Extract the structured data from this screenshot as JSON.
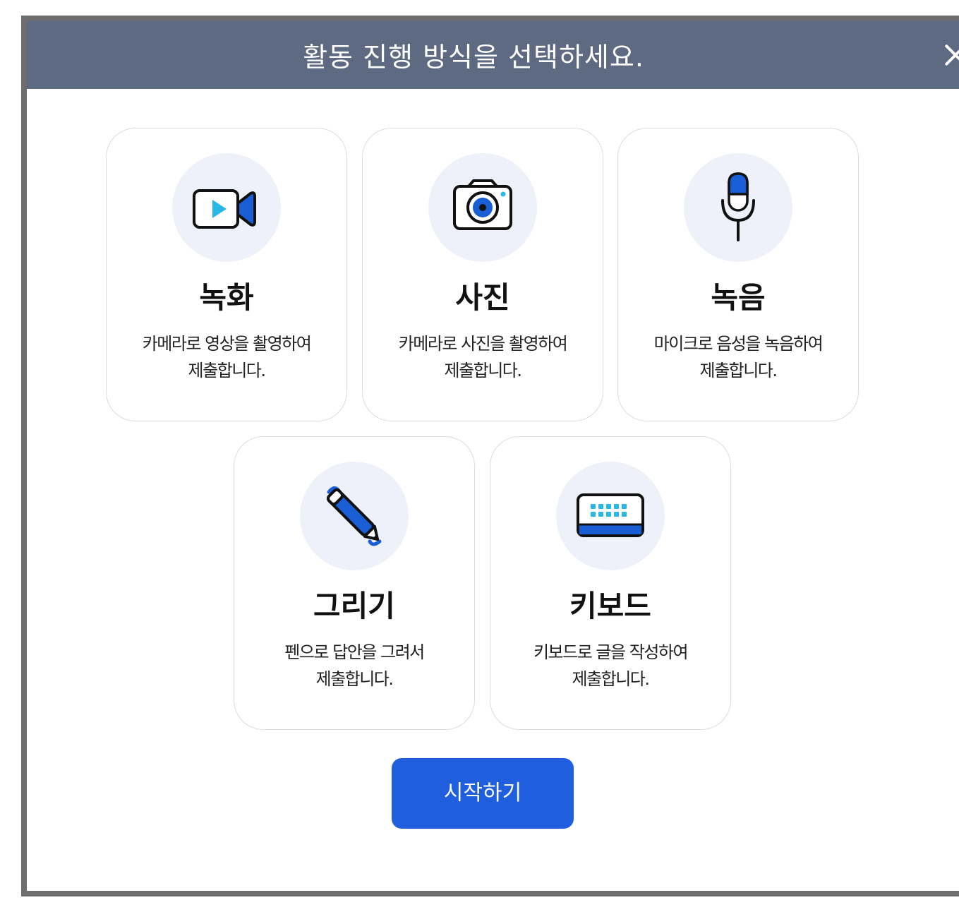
{
  "dialog": {
    "title": "활동 진행 방식을 선택하세요.",
    "close_icon": "close-icon"
  },
  "options": [
    {
      "icon": "video-camera-icon",
      "title": "녹화",
      "desc_line1": "카메라로 영상을 촬영하여",
      "desc_line2": "제출합니다."
    },
    {
      "icon": "camera-icon",
      "title": "사진",
      "desc_line1": "카메라로 사진을 촬영하여",
      "desc_line2": "제출합니다."
    },
    {
      "icon": "microphone-icon",
      "title": "녹음",
      "desc_line1": "마이크로 음성을 녹음하여",
      "desc_line2": "제출합니다."
    },
    {
      "icon": "pen-icon",
      "title": "그리기",
      "desc_line1": "펜으로 답안을 그려서",
      "desc_line2": "제출합니다."
    },
    {
      "icon": "keyboard-icon",
      "title": "키보드",
      "desc_line1": "키보드로 글을 작성하여",
      "desc_line2": "제출합니다."
    }
  ],
  "start_button": {
    "label": "시작하기"
  },
  "colors": {
    "header": "#5e6a82",
    "accent": "#1f5fde",
    "icon_blue": "#1a5ed6",
    "icon_cyan": "#29b7e8",
    "icon_bg": "#eef1f9"
  }
}
